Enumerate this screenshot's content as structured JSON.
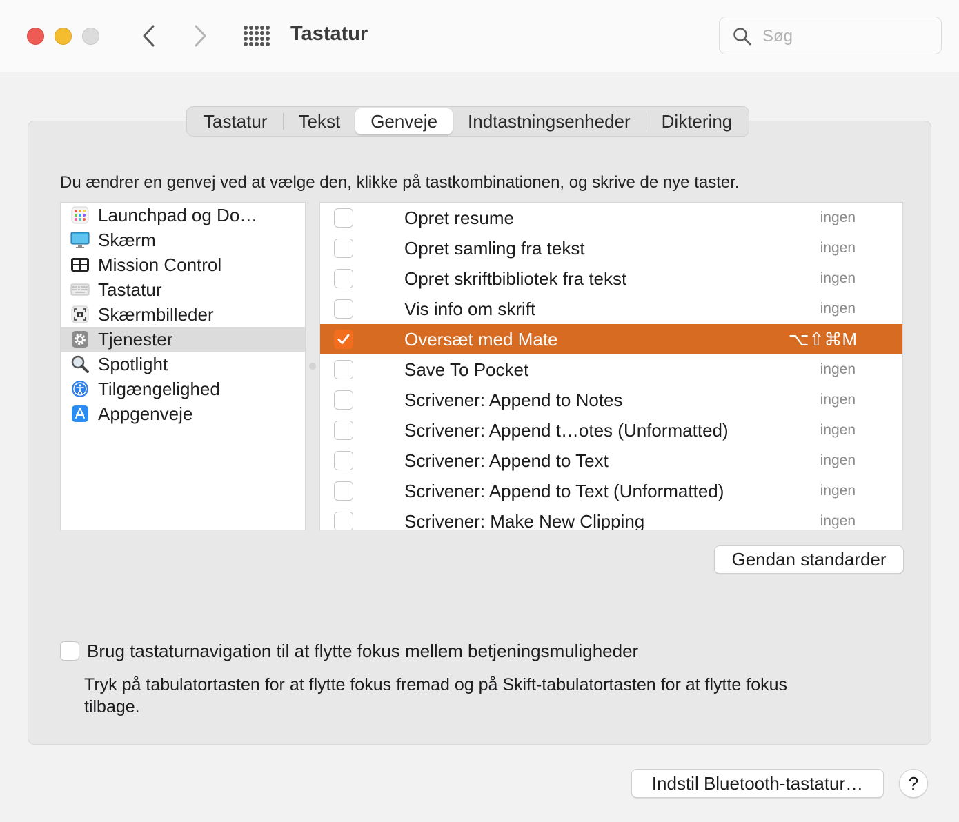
{
  "window": {
    "title": "Tastatur",
    "search_placeholder": "Søg"
  },
  "tabs": [
    {
      "label": "Tastatur",
      "active": false
    },
    {
      "label": "Tekst",
      "active": false
    },
    {
      "label": "Genveje",
      "active": true
    },
    {
      "label": "Indtastningsenheder",
      "active": false
    },
    {
      "label": "Diktering",
      "active": false
    }
  ],
  "instruction": "Du ændrer en genvej ved at vælge den, klikke på tastkombinationen, og skrive de nye taster.",
  "categories": [
    {
      "label": "Launchpad og Do…",
      "icon": "launchpad-icon"
    },
    {
      "label": "Skærm",
      "icon": "display-icon"
    },
    {
      "label": "Mission Control",
      "icon": "mission-control-icon"
    },
    {
      "label": "Tastatur",
      "icon": "keyboard-icon"
    },
    {
      "label": "Skærmbilleder",
      "icon": "screenshot-icon"
    },
    {
      "label": "Tjenester",
      "icon": "gear-icon",
      "selected": true
    },
    {
      "label": "Spotlight",
      "icon": "magnifier-icon"
    },
    {
      "label": "Tilgængelighed",
      "icon": "accessibility-icon"
    },
    {
      "label": "Appgenveje",
      "icon": "app-store-icon"
    }
  ],
  "services": [
    {
      "label": "Opret resume",
      "shortcut": "ingen",
      "checked": false
    },
    {
      "label": "Opret samling fra tekst",
      "shortcut": "ingen",
      "checked": false
    },
    {
      "label": "Opret skriftbibliotek fra tekst",
      "shortcut": "ingen",
      "checked": false
    },
    {
      "label": "Vis info om skrift",
      "shortcut": "ingen",
      "checked": false
    },
    {
      "label": "Oversæt med Mate",
      "shortcut": "⌥⇧⌘M",
      "checked": true,
      "selected": true
    },
    {
      "label": "Save To Pocket",
      "shortcut": "ingen",
      "checked": false
    },
    {
      "label": "Scrivener: Append to Notes",
      "shortcut": "ingen",
      "checked": false
    },
    {
      "label": "Scrivener: Append t…otes (Unformatted)",
      "shortcut": "ingen",
      "checked": false
    },
    {
      "label": "Scrivener: Append to Text",
      "shortcut": "ingen",
      "checked": false
    },
    {
      "label": "Scrivener: Append to Text (Unformatted)",
      "shortcut": "ingen",
      "checked": false
    },
    {
      "label": "Scrivener: Make New Clipping",
      "shortcut": "ingen",
      "checked": false
    }
  ],
  "buttons": {
    "restore": "Gendan standarder",
    "bluetooth": "Indstil Bluetooth-tastatur…",
    "help": "?"
  },
  "keyboard_navigation": {
    "label": "Brug tastaturnavigation til at flytte fokus mellem betjeningsmuligheder",
    "checked": false,
    "description": "Tryk på tabulatortasten for at flytte fokus fremad og på Skift-tabulatortasten for at flytte fokus tilbage."
  },
  "colors": {
    "selection": "#d76b21",
    "checkbox_checked": "#f36d1e",
    "close": "#ee5b55",
    "minimize": "#f4bc2f"
  }
}
